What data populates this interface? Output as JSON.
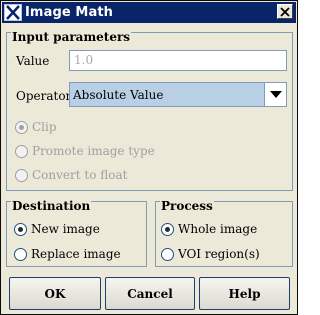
{
  "window": {
    "title": "Image Math",
    "close_label": "X"
  },
  "input_parameters": {
    "title": "Input parameters",
    "value_label": "Value",
    "value": "1.0",
    "operator_label": "Operator",
    "operator_selected": "Absolute Value",
    "options": {
      "clip": "Clip",
      "promote": "Promote image type",
      "convert": "Convert to float"
    }
  },
  "destination": {
    "title": "Destination",
    "new_image": "New image",
    "replace_image": "Replace image"
  },
  "process": {
    "title": "Process",
    "whole_image": "Whole image",
    "voi": "VOI region(s)"
  },
  "buttons": {
    "ok": "OK",
    "cancel": "Cancel",
    "help": "Help"
  },
  "icons": {
    "app": "app-x-icon",
    "close": "close-icon",
    "dropdown": "triangle-down-icon"
  }
}
